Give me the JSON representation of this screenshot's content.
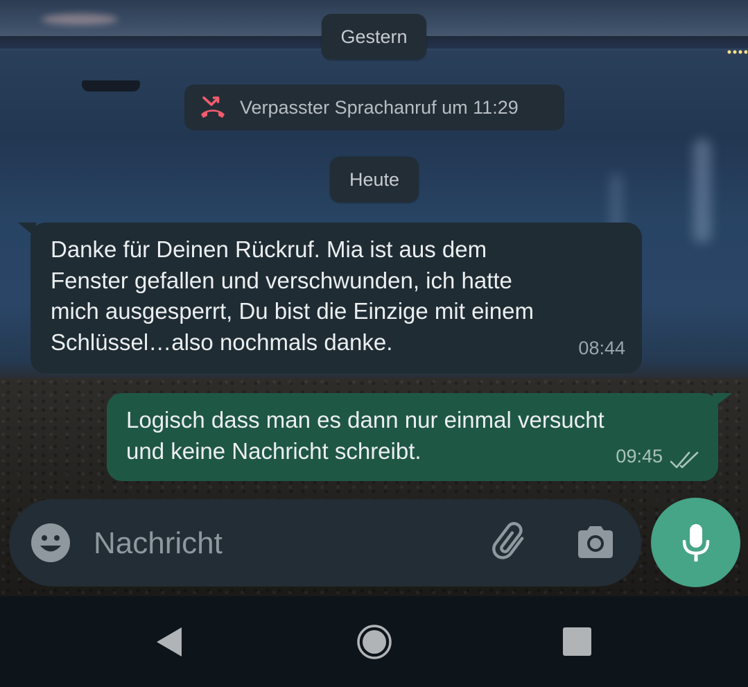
{
  "chat": {
    "date_separator_1": "Gestern",
    "missed_call": {
      "text": "Verpasster Sprachanruf um 11:29",
      "icon": "missed-call-icon",
      "color": "#f15c6d"
    },
    "date_separator_2": "Heute",
    "messages": [
      {
        "direction": "incoming",
        "text": "Danke für Deinen Rückruf. Mia ist aus dem\nFenster gefallen und verschwunden, ich hatte\nmich ausgesperrt, Du bist die Einzige mit einem\nSchlüssel…also nochmals danke.",
        "time": "08:44"
      },
      {
        "direction": "outgoing",
        "text": "Logisch dass man es dann nur einmal versucht\nund keine Nachricht schreibt.",
        "time": "09:45",
        "status": "delivered"
      }
    ]
  },
  "composer": {
    "placeholder": "Nachricht",
    "icons": [
      "emoji-icon",
      "attach-icon",
      "camera-icon",
      "mic-icon"
    ],
    "send_button_color": "#46a487"
  },
  "navbar": {
    "icons": [
      "back-icon",
      "home-icon",
      "recents-icon"
    ]
  }
}
